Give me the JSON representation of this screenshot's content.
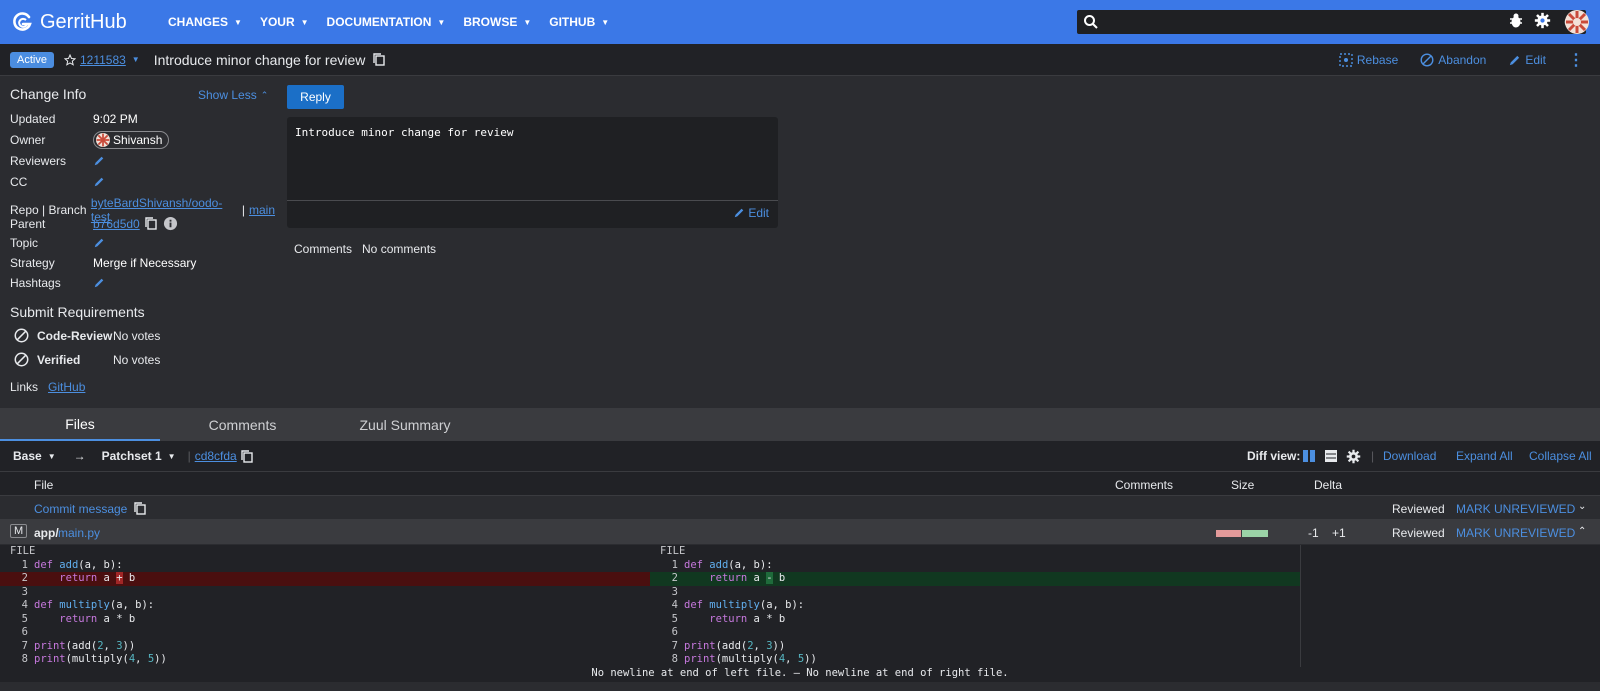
{
  "app": {
    "name": "GerritHub",
    "nav": [
      "CHANGES",
      "YOUR",
      "DOCUMENTATION",
      "BROWSE",
      "GITHUB"
    ],
    "search_value": ""
  },
  "change": {
    "status": "Active",
    "number": "1211583",
    "title": "Introduce minor change for review",
    "actions": [
      "Rebase",
      "Abandon",
      "Edit"
    ]
  },
  "info": {
    "heading": "Change Info",
    "show_less": "Show Less",
    "rows": {
      "updated_label": "Updated",
      "updated_value": "9:02 PM",
      "owner_label": "Owner",
      "owner_value": "Shivansh",
      "reviewers_label": "Reviewers",
      "cc_label": "CC",
      "repo_label": "Repo | Branch",
      "repo_value": "byteBardShivansh/oodo-test",
      "branch_sep": "|",
      "branch_value": "main",
      "parent_label": "Parent",
      "parent_value": "b76d5d0",
      "topic_label": "Topic",
      "strategy_label": "Strategy",
      "strategy_value": "Merge if Necessary",
      "hashtags_label": "Hashtags"
    },
    "submit_heading": "Submit Requirements",
    "requirements": [
      {
        "name": "Code-Review",
        "status": "No votes"
      },
      {
        "name": "Verified",
        "status": "No votes"
      }
    ],
    "links_label": "Links",
    "links_value": "GitHub"
  },
  "reply": {
    "button": "Reply",
    "commit_message": "Introduce minor change for review",
    "edit": "Edit",
    "comments_label": "Comments",
    "comments_value": "No comments"
  },
  "tabs": [
    "Files",
    "Comments",
    "Zuul Summary"
  ],
  "filebar": {
    "base": "Base",
    "arrow": "→",
    "patchset": "Patchset 1",
    "commit": "cd8cfda",
    "diff_view": "Diff view:",
    "download": "Download",
    "expand_all": "Expand All",
    "collapse_all": "Collapse All"
  },
  "file_table": {
    "headers": {
      "file": "File",
      "comments": "Comments",
      "size": "Size",
      "delta": "Delta"
    },
    "commit_row": {
      "name": "Commit message",
      "reviewed": "Reviewed",
      "mark": "MARK UNREVIEWED"
    },
    "file_row": {
      "status": "M",
      "dir": "app/",
      "name": "main.py",
      "delta_minus": "-1",
      "delta_plus": "+1",
      "reviewed": "Reviewed",
      "mark": "MARK UNREVIEWED"
    }
  },
  "diff": {
    "file_label": "FILE",
    "footer": "No newline at end of left file. — No newline at end of right file."
  },
  "colors": {
    "header": "#3b78e7",
    "accent": "#4c8fe0",
    "background": "#2b2c30",
    "deleted": "#4a0f0f",
    "added": "#113820"
  }
}
